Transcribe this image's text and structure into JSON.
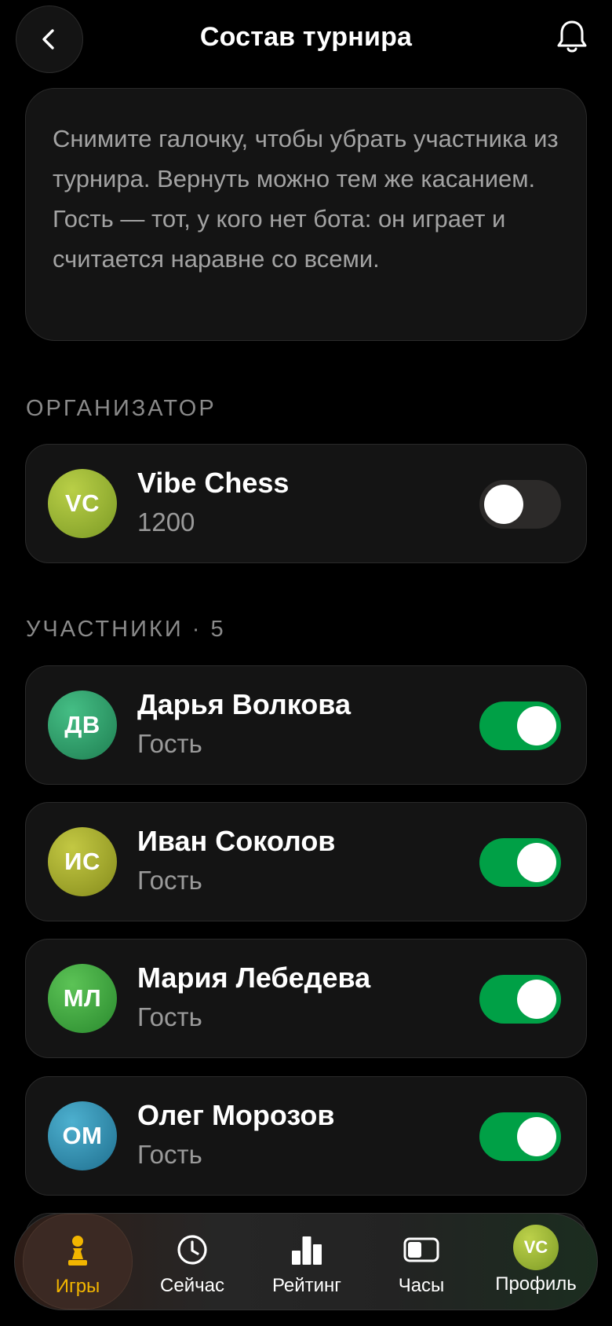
{
  "header": {
    "title": "Состав турнира"
  },
  "info": {
    "text": "Снимите галочку, чтобы убрать участника из турнира. Вернуть можно тем же касанием. Гость — тот, у кого нет бота: он играет и считается наравне со всеми."
  },
  "organizer_section": {
    "label": "ОРГАНИЗАТОР"
  },
  "organizer": {
    "initials": "VC",
    "name": "Vibe Chess",
    "sub": "1200",
    "enabled": false
  },
  "participants_section": {
    "label": "УЧАСТНИКИ · 5"
  },
  "participants": [
    {
      "initials": "ДВ",
      "name": "Дарья Волкова",
      "sub": "Гость",
      "enabled": true,
      "color": "#2e9e6a"
    },
    {
      "initials": "ИС",
      "name": "Иван Соколов",
      "sub": "Гость",
      "enabled": true,
      "color": "#a6ae2c"
    },
    {
      "initials": "МЛ",
      "name": "Мария Лебедева",
      "sub": "Гость",
      "enabled": true,
      "color": "#3aa53e"
    },
    {
      "initials": "ОМ",
      "name": "Олег Морозов",
      "sub": "Гость",
      "enabled": true,
      "color": "#2f8fb0"
    }
  ],
  "tabs": [
    {
      "label": "Игры",
      "icon": "pawn-icon",
      "active": true
    },
    {
      "label": "Сейчас",
      "icon": "clock-icon",
      "active": false
    },
    {
      "label": "Рейтинг",
      "icon": "bar-chart-icon",
      "active": false
    },
    {
      "label": "Часы",
      "icon": "chess-clock-icon",
      "active": false
    },
    {
      "label": "Профиль",
      "icon": "avatar",
      "initials": "VC",
      "active": false
    }
  ],
  "colors": {
    "accent": "#f2b500",
    "toggle_on": "#00a046",
    "background": "#000000"
  }
}
